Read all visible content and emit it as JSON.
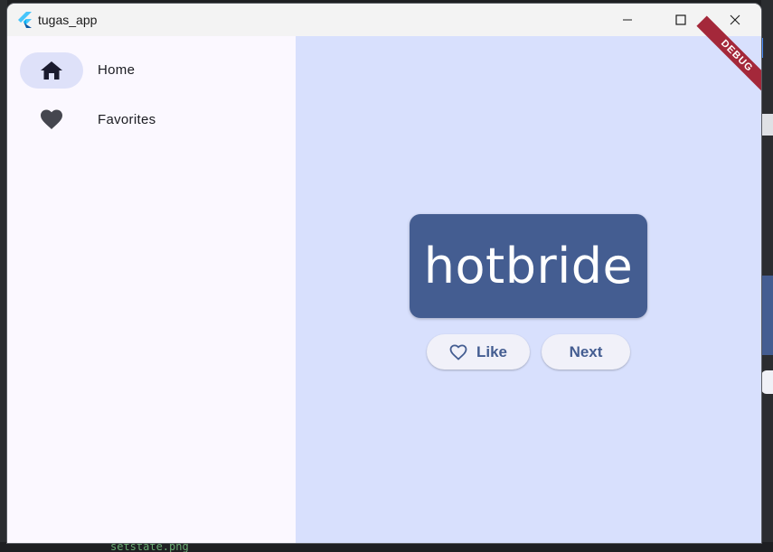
{
  "window": {
    "title": "tugas_app",
    "controls": {
      "minimize_icon": "minimize-icon",
      "maximize_icon": "maximize-icon",
      "close_icon": "close-icon"
    }
  },
  "nav": {
    "items": [
      {
        "label": "Home",
        "icon": "home-icon",
        "selected": true
      },
      {
        "label": "Favorites",
        "icon": "heart-icon",
        "selected": false
      }
    ]
  },
  "main": {
    "word": "hotbride",
    "like_label": "Like",
    "next_label": "Next",
    "debug_banner": "DEBUG"
  },
  "background": {
    "file_label": "setstate.png"
  },
  "colors": {
    "primary": "#445d91",
    "main_bg": "#d8e0fd",
    "nav_bg": "#fbf8ff",
    "indicator": "#dee1f9",
    "debug": "#a4283a"
  }
}
